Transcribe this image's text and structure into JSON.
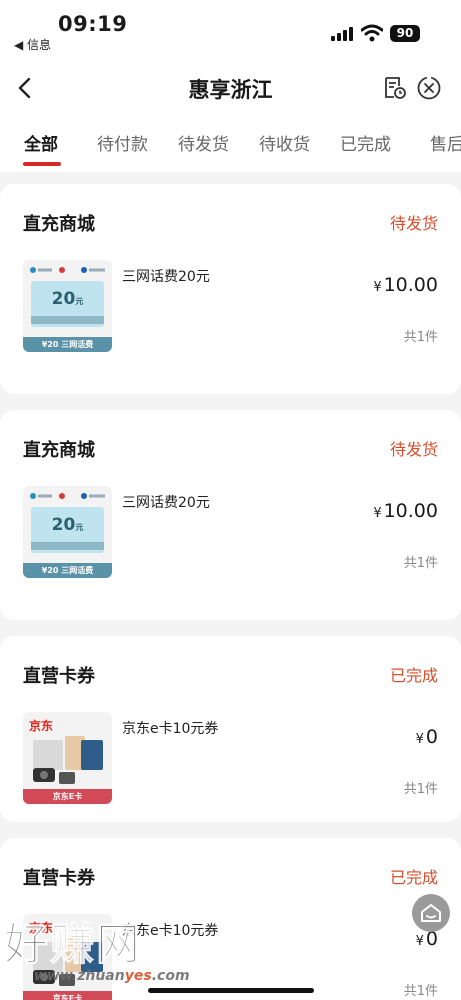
{
  "status_bar": {
    "time": "09:19",
    "back_label": "◀ 信息",
    "battery": "90"
  },
  "nav": {
    "title": "惠享浙江"
  },
  "tabs": [
    {
      "label": "全部",
      "active": true
    },
    {
      "label": "待付款"
    },
    {
      "label": "待发货"
    },
    {
      "label": "待收货"
    },
    {
      "label": "已完成"
    },
    {
      "label": "售后"
    }
  ],
  "orders": [
    {
      "store": "直充商城",
      "status": "待发货",
      "item": "三网话费20元",
      "currency": "¥",
      "price": "10.00",
      "count": "共1件",
      "thumb_amount": "20",
      "thumb_unit": "元",
      "thumb_strip": "¥20 三网话费"
    },
    {
      "store": "直充商城",
      "status": "待发货",
      "item": "三网话费20元",
      "currency": "¥",
      "price": "10.00",
      "count": "共1件",
      "thumb_amount": "20",
      "thumb_unit": "元",
      "thumb_strip": "¥20 三网话费"
    },
    {
      "store": "直营卡券",
      "status": "已完成",
      "item": "京东e卡10元券",
      "currency": "¥",
      "price": "0",
      "count": "共1件",
      "thumb_brand": "京东",
      "thumb_strip": "京东E卡"
    },
    {
      "store": "直营卡券",
      "status": "已完成",
      "item": "京东e卡10元券",
      "currency": "¥",
      "price": "0",
      "count": "共1件",
      "thumb_brand": "京东",
      "thumb_strip": "京东E卡"
    }
  ],
  "watermark": {
    "title": "好赚网",
    "url_prefix": "www.zhuan",
    "url_accent": "yes",
    "url_suffix": ".com"
  },
  "icons": {
    "back": "chevron-left-icon",
    "receipt": "receipt-clock-icon",
    "close": "close-circle-icon",
    "home": "home-icon"
  },
  "colors": {
    "accent": "#d62a2a",
    "status": "#d64f2e"
  }
}
